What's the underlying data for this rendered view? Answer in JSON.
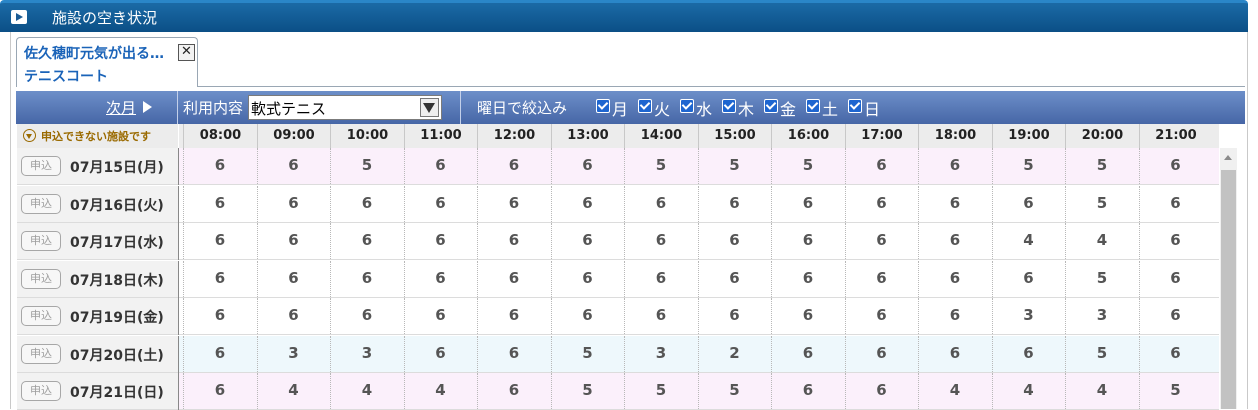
{
  "title": "施設の空き状況",
  "tab": {
    "facility": "佐久穂町元気が出る…",
    "court": "テニスコート",
    "close": "✕"
  },
  "toolbar": {
    "next_month": "次月",
    "usage_label": "利用内容",
    "usage_value": "軟式テニス",
    "day_filter_label": "曜日で絞込み",
    "days": [
      "月",
      "火",
      "水",
      "木",
      "金",
      "土",
      "日"
    ]
  },
  "legend_no_facility": "申込できない施設です",
  "apply_label": "申込",
  "times": [
    "08:00",
    "09:00",
    "10:00",
    "11:00",
    "12:00",
    "13:00",
    "14:00",
    "15:00",
    "16:00",
    "17:00",
    "18:00",
    "19:00",
    "20:00",
    "21:00"
  ],
  "rows": [
    {
      "date": "07月15日(月)",
      "bg": "#fbf0fb",
      "values": [
        "6",
        "6",
        "5",
        "6",
        "6",
        "6",
        "5",
        "5",
        "5",
        "6",
        "6",
        "5",
        "5",
        "6"
      ]
    },
    {
      "date": "07月16日(火)",
      "bg": "#ffffff",
      "values": [
        "6",
        "6",
        "6",
        "6",
        "6",
        "6",
        "6",
        "6",
        "6",
        "6",
        "6",
        "6",
        "5",
        "6"
      ]
    },
    {
      "date": "07月17日(水)",
      "bg": "#ffffff",
      "values": [
        "6",
        "6",
        "6",
        "6",
        "6",
        "6",
        "6",
        "6",
        "6",
        "6",
        "6",
        "4",
        "4",
        "6"
      ]
    },
    {
      "date": "07月18日(木)",
      "bg": "#ffffff",
      "values": [
        "6",
        "6",
        "6",
        "6",
        "6",
        "6",
        "6",
        "6",
        "6",
        "6",
        "6",
        "6",
        "5",
        "6"
      ]
    },
    {
      "date": "07月19日(金)",
      "bg": "#ffffff",
      "values": [
        "6",
        "6",
        "6",
        "6",
        "6",
        "6",
        "6",
        "6",
        "6",
        "6",
        "6",
        "3",
        "3",
        "6"
      ]
    },
    {
      "date": "07月20日(土)",
      "bg": "#eef8fc",
      "values": [
        "6",
        "3",
        "3",
        "6",
        "6",
        "5",
        "3",
        "2",
        "6",
        "6",
        "6",
        "6",
        "5",
        "6"
      ]
    },
    {
      "date": "07月21日(日)",
      "bg": "#fbf0fb",
      "values": [
        "6",
        "4",
        "4",
        "4",
        "6",
        "5",
        "5",
        "5",
        "6",
        "6",
        "4",
        "4",
        "4",
        "5"
      ]
    }
  ]
}
